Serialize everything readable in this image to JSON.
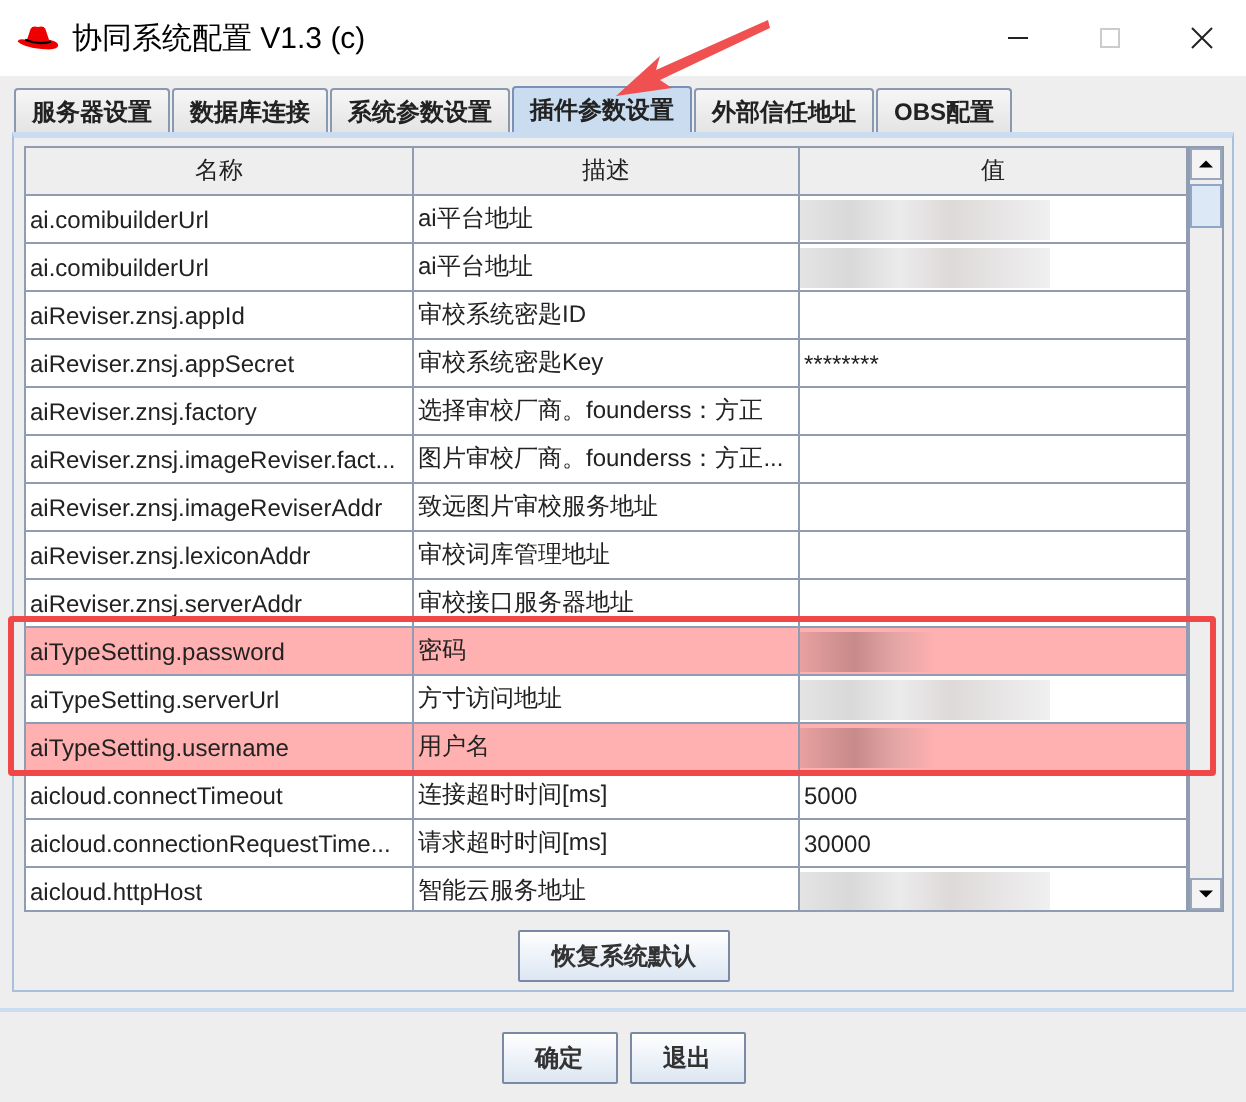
{
  "window": {
    "title": "协同系统配置 V1.3 (c)"
  },
  "tabs": [
    {
      "label": "服务器设置",
      "selected": false
    },
    {
      "label": "数据库连接",
      "selected": false
    },
    {
      "label": "系统参数设置",
      "selected": false
    },
    {
      "label": "插件参数设置",
      "selected": true
    },
    {
      "label": "外部信任地址",
      "selected": false
    },
    {
      "label": "OBS配置",
      "selected": false
    }
  ],
  "table": {
    "columns": [
      "名称",
      "描述",
      "值"
    ],
    "rows": [
      {
        "name": "ai.comibuilderUrl",
        "description": "ai平台地址",
        "redacted": true,
        "selected": false
      },
      {
        "name": "ai.comibuilderUrl",
        "description": "ai平台地址",
        "redacted": true,
        "selected": false
      },
      {
        "name": "aiReviser.znsj.appId",
        "description": "审校系统密匙ID",
        "redacted": false,
        "selected": false
      },
      {
        "name": "aiReviser.znsj.appSecret",
        "description": "审校系统密匙Key",
        "value": "********",
        "redacted": false,
        "selected": false
      },
      {
        "name": "aiReviser.znsj.factory",
        "description": "选择审校厂商。founderss：方正",
        "redacted": false,
        "selected": false
      },
      {
        "name": "aiReviser.znsj.imageReviser.fact...",
        "description": "图片审校厂商。founderss：方正...",
        "redacted": false,
        "selected": false
      },
      {
        "name": "aiReviser.znsj.imageReviserAddr",
        "description": "致远图片审校服务地址",
        "redacted": false,
        "selected": false
      },
      {
        "name": "aiReviser.znsj.lexiconAddr",
        "description": "审校词库管理地址",
        "redacted": false,
        "selected": false
      },
      {
        "name": "aiReviser.znsj.serverAddr",
        "description": "审校接口服务器地址",
        "redacted": false,
        "selected": false
      },
      {
        "name": "aiTypeSetting.password",
        "description": "密码",
        "redacted": true,
        "selected": true
      },
      {
        "name": "aiTypeSetting.serverUrl",
        "description": "方寸访问地址",
        "redacted": true,
        "selected": false
      },
      {
        "name": "aiTypeSetting.username",
        "description": "用户名",
        "redacted": true,
        "selected": true
      },
      {
        "name": "aicloud.connectTimeout",
        "description": "连接超时时间[ms]",
        "value": "5000",
        "redacted": false,
        "selected": false
      },
      {
        "name": "aicloud.connectionRequestTime...",
        "description": "请求超时时间[ms]",
        "value": "30000",
        "redacted": false,
        "selected": false
      },
      {
        "name": "aicloud.httpHost",
        "description": "智能云服务地址",
        "redacted": true,
        "selected": false
      }
    ]
  },
  "restore_button": "恢复系统默认",
  "buttons": [
    "确定",
    "退出"
  ]
}
